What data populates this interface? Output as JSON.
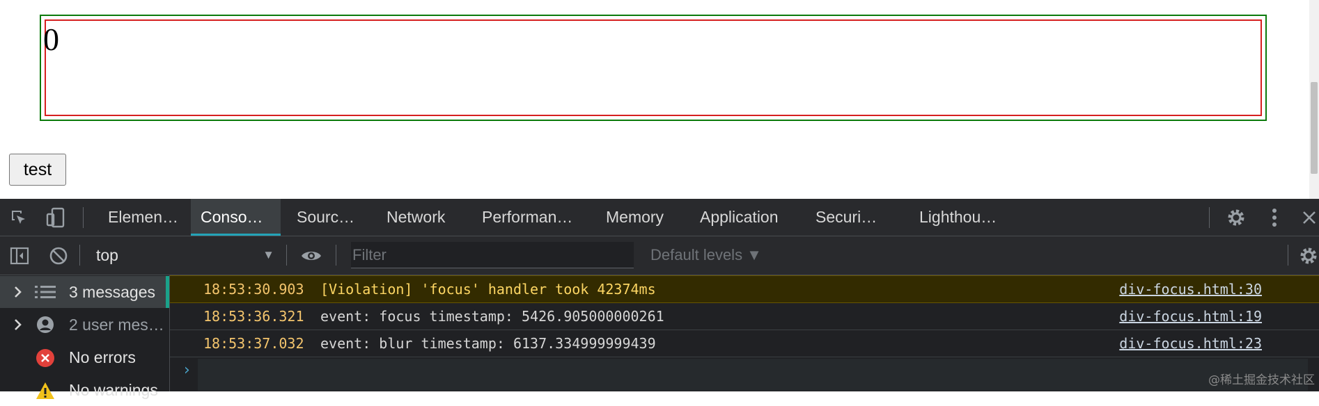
{
  "page": {
    "counter_value": "0",
    "button_label": "test"
  },
  "devtools": {
    "tabs": [
      {
        "label": "Elemen…",
        "active": false
      },
      {
        "label": "Conso…",
        "active": true
      },
      {
        "label": "Sourc…",
        "active": false
      },
      {
        "label": "Network",
        "active": false
      },
      {
        "label": "Performan…",
        "active": false
      },
      {
        "label": "Memory",
        "active": false
      },
      {
        "label": "Application",
        "active": false
      },
      {
        "label": "Securi…",
        "active": false
      },
      {
        "label": "Lighthou…",
        "active": false
      }
    ],
    "toolbar": {
      "context": "top",
      "filter_placeholder": "Filter",
      "levels_label": "Default levels ▼"
    },
    "sidebar": {
      "items": [
        {
          "label": "3 messages",
          "icon": "list-icon",
          "selected": true
        },
        {
          "label": "2 user mes…",
          "icon": "user-icon",
          "selected": false
        },
        {
          "label": "No errors",
          "icon": "error-icon",
          "selected": false
        },
        {
          "label": "No warnings",
          "icon": "warning-icon",
          "selected": false
        }
      ]
    },
    "console": {
      "messages": [
        {
          "time": "18:53:30.903",
          "text": "[Violation] 'focus' handler took 42374ms",
          "source": "div-focus.html:30",
          "level": "warning"
        },
        {
          "time": "18:53:36.321",
          "text": "event: focus timestamp: 5426.905000000261",
          "source": "div-focus.html:19",
          "level": "info"
        },
        {
          "time": "18:53:37.032",
          "text": "event: blur timestamp: 6137.334999999439",
          "source": "div-focus.html:23",
          "level": "info"
        }
      ],
      "prompt_symbol": "›"
    }
  },
  "watermark": "@稀土掘金技术社区",
  "colors": {
    "outer_border": "#0b7a0b",
    "inner_border": "#d61f1f",
    "active_tab_accent": "#24a3b8",
    "timestamp": "#f4c56d",
    "warning_bg": "#332b00"
  }
}
